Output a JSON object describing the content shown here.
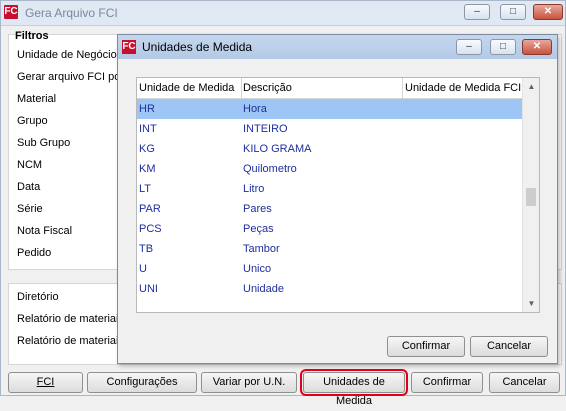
{
  "main_window": {
    "title": "Gera Arquivo FCI",
    "icon": "FC",
    "minimize": "–",
    "maximize": "□",
    "close": "✕"
  },
  "filters": {
    "title": "Filtros",
    "labels": [
      "Unidade de Negócio",
      "Gerar arquivo FCI po",
      "Material",
      "Grupo",
      "Sub Grupo",
      "NCM",
      "Data",
      "Série",
      "Nota Fiscal",
      "Pedido"
    ]
  },
  "output": {
    "labels": [
      "Diretório",
      "Relatório de materiai",
      "Relatório de materiai"
    ]
  },
  "bottom_buttons": [
    {
      "label": "FCI",
      "name": "fci-button"
    },
    {
      "label": "Configurações",
      "name": "configuracoes-button"
    },
    {
      "label": "Variar por U.N.",
      "name": "variar-por-un-button"
    },
    {
      "label": "Unidades de Medida",
      "name": "unidades-de-medida-button"
    },
    {
      "label": "Confirmar",
      "name": "confirmar-button"
    },
    {
      "label": "Cancelar",
      "name": "cancelar-button"
    }
  ],
  "dialog": {
    "title": "Unidades de Medida",
    "icon": "FC",
    "minimize": "–",
    "maximize": "□",
    "close": "✕",
    "columns": [
      "Unidade de Medida",
      "Descrição",
      "Unidade de Medida FCI"
    ],
    "rows": [
      {
        "unit": "HR",
        "desc": "Hora",
        "fci": ""
      },
      {
        "unit": "INT",
        "desc": "INTEIRO",
        "fci": ""
      },
      {
        "unit": "KG",
        "desc": "KILO GRAMA",
        "fci": ""
      },
      {
        "unit": "KM",
        "desc": "Quilometro",
        "fci": ""
      },
      {
        "unit": "LT",
        "desc": "Litro",
        "fci": ""
      },
      {
        "unit": "PAR",
        "desc": "Pares",
        "fci": ""
      },
      {
        "unit": "PCS",
        "desc": "Peças",
        "fci": ""
      },
      {
        "unit": "TB",
        "desc": "Tambor",
        "fci": ""
      },
      {
        "unit": "U",
        "desc": "Unico",
        "fci": ""
      },
      {
        "unit": "UNI",
        "desc": "Unidade",
        "fci": ""
      }
    ],
    "scroll_up": "▲",
    "scroll_down": "▼",
    "confirm_label": "Confirmar",
    "cancel_label": "Cancelar"
  },
  "colors": {
    "selection": "#9ec6f4",
    "row_text": "#1f2f9f",
    "highlight_box": "#e1001a"
  }
}
